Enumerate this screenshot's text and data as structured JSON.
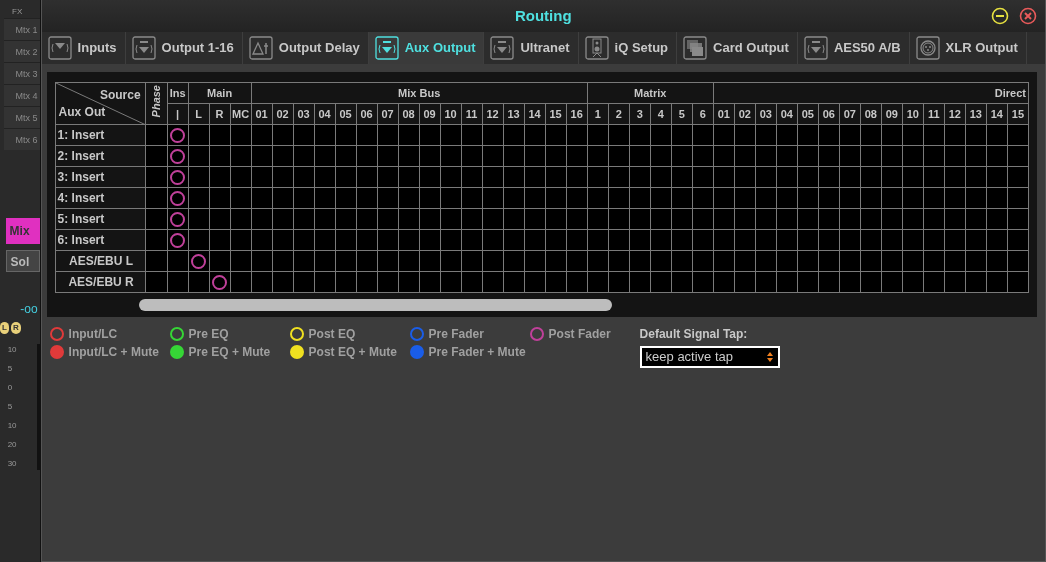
{
  "background_strip": {
    "fx_label": "FX",
    "matrix_labels": [
      "Mtx 1",
      "Mtx 2",
      "Mtx 3",
      "Mtx 4",
      "Mtx 5",
      "Mtx 6"
    ],
    "mix_button": "Mix",
    "solo_button": "Sol",
    "level_reading": "-oo",
    "pan_labels": [
      "L",
      "R"
    ],
    "scale": [
      "10",
      "5",
      "0",
      "5",
      "10",
      "20",
      "30"
    ]
  },
  "window": {
    "title": "Routing"
  },
  "tabs": [
    {
      "label": "Inputs",
      "selected": false
    },
    {
      "label": "Output 1-16",
      "selected": false
    },
    {
      "label": "Output Delay",
      "selected": false
    },
    {
      "label": "Aux Output",
      "selected": true
    },
    {
      "label": "Ultranet",
      "selected": false
    },
    {
      "label": "iQ Setup",
      "selected": false
    },
    {
      "label": "Card Output",
      "selected": false
    },
    {
      "label": "AES50 A/B",
      "selected": false
    },
    {
      "label": "XLR Output",
      "selected": false
    }
  ],
  "grid": {
    "source_label": "Source",
    "target_label": "Aux Out",
    "phase_label": "Phase",
    "groups": [
      {
        "label": "Ins",
        "columns": [
          "|"
        ]
      },
      {
        "label": "Main",
        "columns": [
          "L",
          "R",
          "MC"
        ]
      },
      {
        "label": "Mix Bus",
        "columns": [
          "01",
          "02",
          "03",
          "04",
          "05",
          "06",
          "07",
          "08",
          "09",
          "10",
          "11",
          "12",
          "13",
          "14",
          "15",
          "16"
        ]
      },
      {
        "label": "Matrix",
        "columns": [
          "1",
          "2",
          "3",
          "4",
          "5",
          "6"
        ]
      },
      {
        "label": "Direct",
        "columns": [
          "01",
          "02",
          "03",
          "04",
          "05",
          "06",
          "07",
          "08",
          "09",
          "10",
          "11",
          "12",
          "13",
          "14",
          "15"
        ]
      }
    ],
    "rows": [
      {
        "label": "1: Insert",
        "kind": "insert",
        "color": "#c0409a",
        "routed": [
          true,
          false,
          false,
          false,
          false,
          false,
          false,
          false,
          false,
          false,
          false,
          false,
          false,
          false,
          false,
          false,
          false,
          false,
          false,
          false,
          false,
          false,
          false,
          false,
          false,
          false,
          false,
          false,
          false,
          false,
          false,
          false,
          false,
          false,
          false,
          false,
          false,
          false,
          false,
          false,
          false
        ]
      },
      {
        "label": "2: Insert",
        "kind": "insert",
        "color": "#c0409a",
        "routed": [
          true,
          false,
          false,
          false,
          false,
          false,
          false,
          false,
          false,
          false,
          false,
          false,
          false,
          false,
          false,
          false,
          false,
          false,
          false,
          false,
          false,
          false,
          false,
          false,
          false,
          false,
          false,
          false,
          false,
          false,
          false,
          false,
          false,
          false,
          false,
          false,
          false,
          false,
          false,
          false,
          false
        ]
      },
      {
        "label": "3: Insert",
        "kind": "insert",
        "color": "#c0409a",
        "routed": [
          true,
          false,
          false,
          false,
          false,
          false,
          false,
          false,
          false,
          false,
          false,
          false,
          false,
          false,
          false,
          false,
          false,
          false,
          false,
          false,
          false,
          false,
          false,
          false,
          false,
          false,
          false,
          false,
          false,
          false,
          false,
          false,
          false,
          false,
          false,
          false,
          false,
          false,
          false,
          false,
          false
        ]
      },
      {
        "label": "4: Insert",
        "kind": "insert",
        "color": "#c0409a",
        "routed": [
          true,
          false,
          false,
          false,
          false,
          false,
          false,
          false,
          false,
          false,
          false,
          false,
          false,
          false,
          false,
          false,
          false,
          false,
          false,
          false,
          false,
          false,
          false,
          false,
          false,
          false,
          false,
          false,
          false,
          false,
          false,
          false,
          false,
          false,
          false,
          false,
          false,
          false,
          false,
          false,
          false
        ]
      },
      {
        "label": "5: Insert",
        "kind": "insert",
        "color": "#c0409a",
        "routed": [
          true,
          false,
          false,
          false,
          false,
          false,
          false,
          false,
          false,
          false,
          false,
          false,
          false,
          false,
          false,
          false,
          false,
          false,
          false,
          false,
          false,
          false,
          false,
          false,
          false,
          false,
          false,
          false,
          false,
          false,
          false,
          false,
          false,
          false,
          false,
          false,
          false,
          false,
          false,
          false,
          false
        ]
      },
      {
        "label": "6: Insert",
        "kind": "insert",
        "color": "#c0409a",
        "routed": [
          true,
          false,
          false,
          false,
          false,
          false,
          false,
          false,
          false,
          false,
          false,
          false,
          false,
          false,
          false,
          false,
          false,
          false,
          false,
          false,
          false,
          false,
          false,
          false,
          false,
          false,
          false,
          false,
          false,
          false,
          false,
          false,
          false,
          false,
          false,
          false,
          false,
          false,
          false,
          false,
          false
        ]
      },
      {
        "label": "AES/EBU L",
        "kind": "aes",
        "color": "#c0409a",
        "routed": [
          false,
          true,
          false,
          false,
          false,
          false,
          false,
          false,
          false,
          false,
          false,
          false,
          false,
          false,
          false,
          false,
          false,
          false,
          false,
          false,
          false,
          false,
          false,
          false,
          false,
          false,
          false,
          false,
          false,
          false,
          false,
          false,
          false,
          false,
          false,
          false,
          false,
          false,
          false,
          false,
          false
        ]
      },
      {
        "label": "AES/EBU R",
        "kind": "aes",
        "color": "#c0409a",
        "routed": [
          false,
          false,
          true,
          false,
          false,
          false,
          false,
          false,
          false,
          false,
          false,
          false,
          false,
          false,
          false,
          false,
          false,
          false,
          false,
          false,
          false,
          false,
          false,
          false,
          false,
          false,
          false,
          false,
          false,
          false,
          false,
          false,
          false,
          false,
          false,
          false,
          false,
          false,
          false,
          false,
          false
        ]
      }
    ]
  },
  "legend": [
    {
      "label": "Input/LC",
      "color": "#e03a3a",
      "filled": false
    },
    {
      "label": "Input/LC + Mute",
      "color": "#e03a3a",
      "filled": true
    },
    {
      "label": "Pre EQ",
      "color": "#36d636",
      "filled": false
    },
    {
      "label": "Pre EQ + Mute",
      "color": "#36d636",
      "filled": true
    },
    {
      "label": "Post EQ",
      "color": "#f0e020",
      "filled": false
    },
    {
      "label": "Post EQ + Mute",
      "color": "#f0e020",
      "filled": true
    },
    {
      "label": "Pre Fader",
      "color": "#1a5de8",
      "filled": false
    },
    {
      "label": "Pre Fader + Mute",
      "color": "#1a5de8",
      "filled": true
    },
    {
      "label": "Post Fader",
      "color": "#c0409a",
      "filled": false
    }
  ],
  "default_tap": {
    "label": "Default Signal Tap:",
    "value": "keep active tap"
  }
}
